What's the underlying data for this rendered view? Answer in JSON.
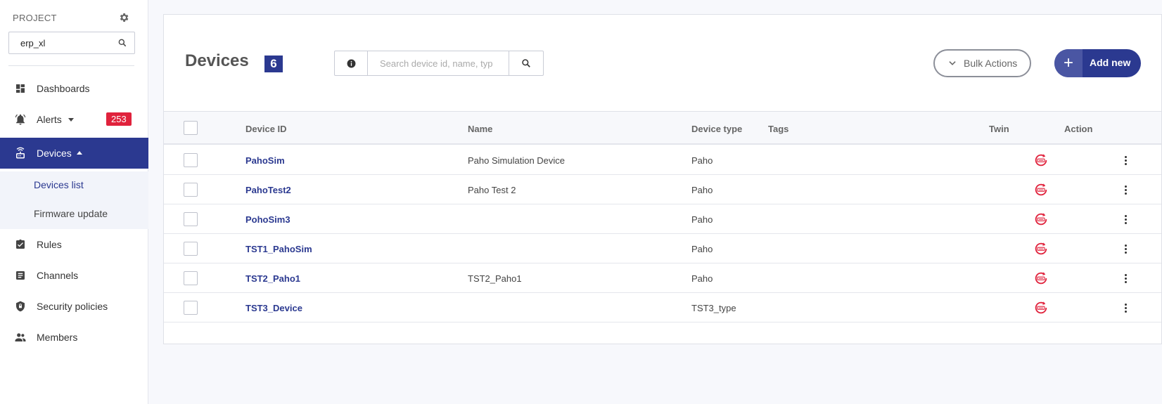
{
  "sidebar": {
    "project_label": "PROJECT",
    "project_value": "erp_xl",
    "nav": [
      {
        "label": "Dashboards"
      },
      {
        "label": "Alerts",
        "badge": "253"
      },
      {
        "label": "Devices"
      },
      {
        "label": "Rules"
      },
      {
        "label": "Channels"
      },
      {
        "label": "Security policies"
      },
      {
        "label": "Members"
      }
    ],
    "sub": [
      {
        "label": "Devices list"
      },
      {
        "label": "Firmware update"
      }
    ]
  },
  "main": {
    "title": "Devices",
    "count": "6",
    "search_placeholder": "Search device id, name, typ",
    "bulk_label": "Bulk Actions",
    "add_label": "Add new",
    "columns": [
      "Device ID",
      "Name",
      "Device type",
      "Tags",
      "Twin",
      "Action"
    ],
    "rows": [
      {
        "id": "PahoSim",
        "name": "Paho Simulation Device",
        "type": "Paho",
        "tags": ""
      },
      {
        "id": "PahoTest2",
        "name": "Paho Test 2",
        "type": "Paho",
        "tags": ""
      },
      {
        "id": "PohoSim3",
        "name": "",
        "type": "Paho",
        "tags": ""
      },
      {
        "id": "TST1_PahoSim",
        "name": "",
        "type": "Paho",
        "tags": ""
      },
      {
        "id": "TST2_Paho1",
        "name": "TST2_Paho1",
        "type": "Paho",
        "tags": ""
      },
      {
        "id": "TST3_Device",
        "name": "",
        "type": "TST3_type",
        "tags": ""
      }
    ]
  },
  "colors": {
    "primary": "#2b3990",
    "badge": "#e0223c",
    "twin": "#e0223c"
  },
  "icons": {
    "project_settings": "gear-icon",
    "search": "search-icon",
    "info": "info-icon",
    "twin": "twin-sync-icon",
    "action": "more-vertical-icon"
  }
}
